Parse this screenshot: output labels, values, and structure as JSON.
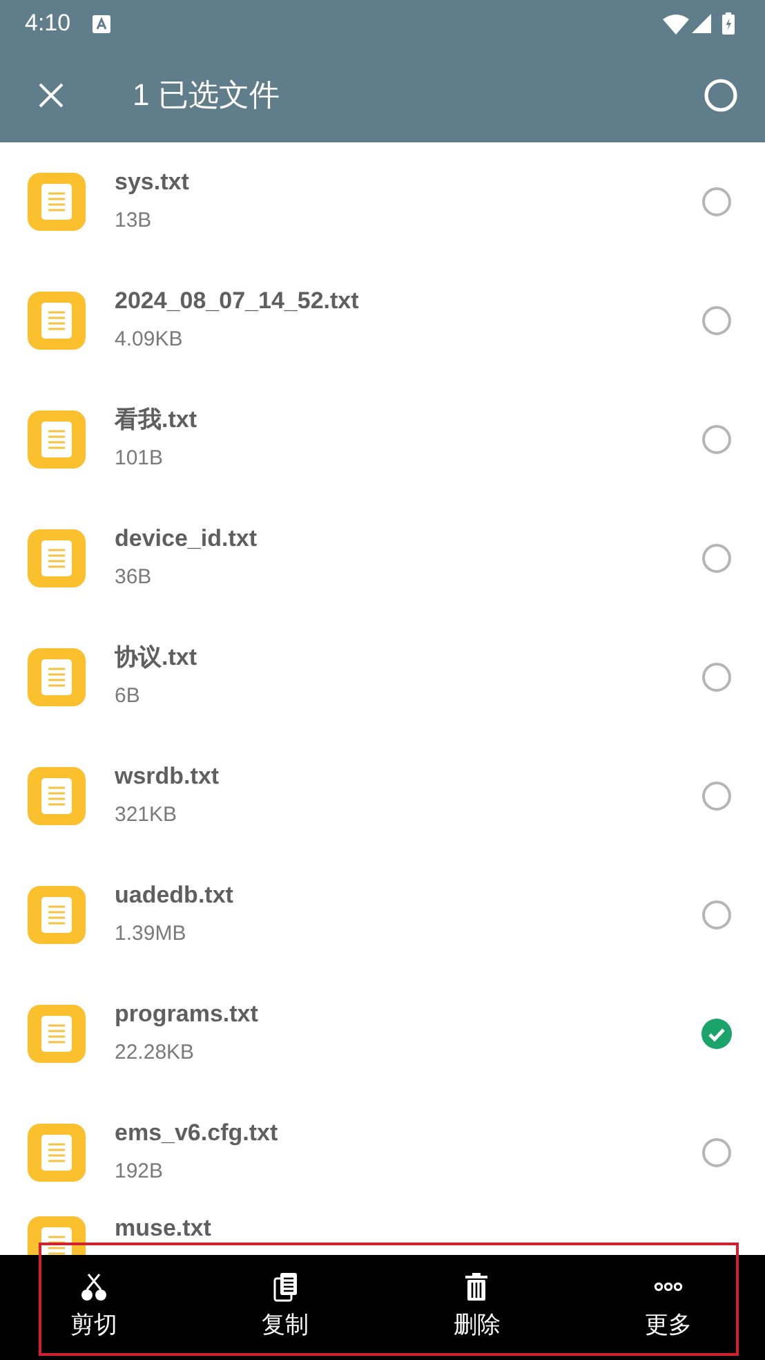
{
  "status_bar": {
    "time": "4:10"
  },
  "app_bar": {
    "title": "1 已选文件",
    "select_all_checked": false
  },
  "files": [
    {
      "name": "sys.txt",
      "size": "13B",
      "selected": false
    },
    {
      "name": "2024_08_07_14_52.txt",
      "size": "4.09KB",
      "selected": false
    },
    {
      "name": "看我.txt",
      "size": "101B",
      "selected": false
    },
    {
      "name": "device_id.txt",
      "size": "36B",
      "selected": false
    },
    {
      "name": "协议.txt",
      "size": "6B",
      "selected": false
    },
    {
      "name": "wsrdb.txt",
      "size": "321KB",
      "selected": false
    },
    {
      "name": "uadedb.txt",
      "size": "1.39MB",
      "selected": false
    },
    {
      "name": "programs.txt",
      "size": "22.28KB",
      "selected": true
    },
    {
      "name": "ems_v6.cfg.txt",
      "size": "192B",
      "selected": false
    },
    {
      "name": "muse.txt"
    }
  ],
  "bottom_bar": {
    "highlighted": true,
    "actions": [
      {
        "kind": "cut",
        "label": "剪切"
      },
      {
        "kind": "copy",
        "label": "复制"
      },
      {
        "kind": "delete",
        "label": "删除"
      },
      {
        "kind": "more",
        "label": "更多"
      }
    ]
  }
}
